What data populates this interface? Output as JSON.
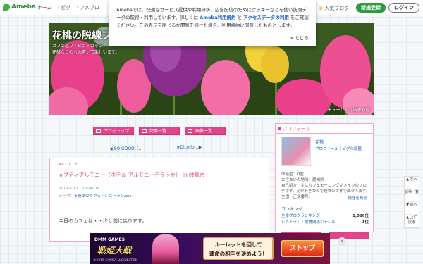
{
  "topbar": {
    "brand": "Ameba",
    "nav": [
      "ホーム",
      "ピグ",
      "アメブロ"
    ],
    "popular": "人気ブログ",
    "register": "新規登録",
    "login": "ログイン"
  },
  "cookie": {
    "text1": "Amebaでは、快適なサービス提供や利用分析、広告配信のためにクッキーなどを使い訪問データの取得・利用しています。詳しくは",
    "link1": "Ameba利用規約",
    "and": "と",
    "link2": "アクセスデータの利用",
    "text2": "をご確認ください。この表示を閉じるか閲覧を続けた場合、利用規約に同意したものとします。",
    "close": "とじる"
  },
  "banner": {
    "title": "花桃の脱線ブ",
    "sub1": "カフェ巡り・ピグ・カップ",
    "sub2": "花桃なりのもの書いて楽しいます。",
    "signature": "チューリップ四季彩館"
  },
  "nav_buttons": [
    "ブログトップ",
    "記事一覧",
    "画像一覧"
  ],
  "pagenav": {
    "prev": "◀ SO GOOD〈…",
    "next": "★Dicollo…▶"
  },
  "article": {
    "theme_tag": "ARTICLE",
    "title": "★ブティアルモニー（ホテル アルモニーテラッセ） in 岐阜市",
    "date": "2017-10-17 17:40:16",
    "theme_label": "テーマ：",
    "theme_link": "★岐阜のカフェ・レストラン/etc",
    "body": "今日のカフェは・・少し前に戻ります。"
  },
  "sidebar": {
    "heading": "プロフィール",
    "name": "花桃",
    "links": "プロフィール｜ピグの部屋",
    "info1": "血液型：O型",
    "info2": "お住まいの地域：愛知県",
    "info3": "自己紹介：主にカフェモーニングがメインのブログです。花が好きなので趣味の世界で載せてます。全国一正規番号。",
    "more": "続きを見る",
    "ranking_title": "ランキング",
    "ranking": [
      {
        "label": "全体ブログランキング",
        "value": "1,086位"
      },
      {
        "label": "レストラン・飲食関係ジャンル",
        "value": "1位"
      }
    ]
  },
  "right_nav": [
    "▲ 次へ",
    "記事一覧",
    "▼ 前へ",
    "▲ 上に戻る"
  ],
  "ad": {
    "maker": "DMM GAMES",
    "logo": "戦姫大戦",
    "copyright": "©2015 EXNOA LLC/NEXTON",
    "bubble1": "ルーレットを回して",
    "bubble2": "運命の相手を決めよう！",
    "stop": "ストップ",
    "close": "×"
  },
  "colors": {
    "accent": "#e0458b",
    "link": "#1a5fb4",
    "brand_green": "#2d9a3e"
  }
}
